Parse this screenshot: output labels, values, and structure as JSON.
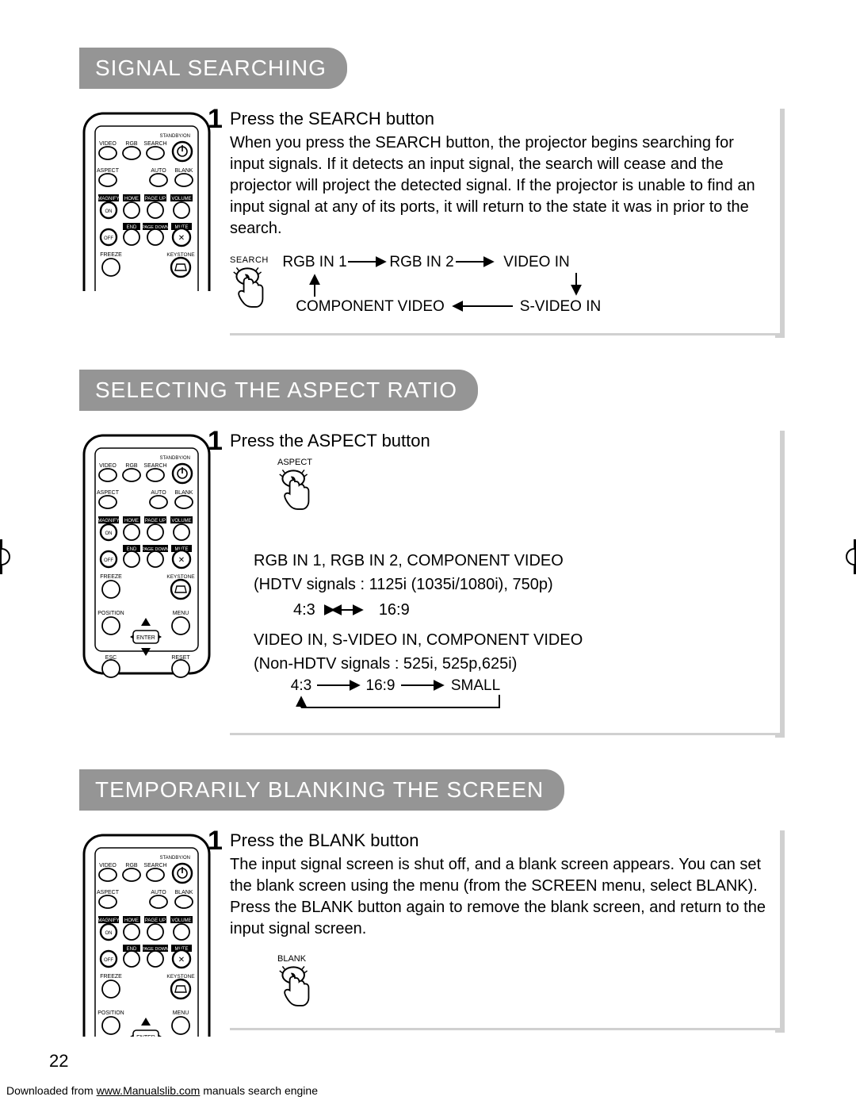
{
  "sections": {
    "s1": {
      "title": "SIGNAL SEARCHING",
      "step_num": "1",
      "step_title": "Press the SEARCH button",
      "body": "When you press the SEARCH button, the projector begins searching for input signals. If it detects an input signal, the search will cease and the projector will project the detected signal. If the projector is unable to find an input signal at any of its ports, it will return to the state it was in prior to the search.",
      "press_label": "SEARCH",
      "flow": {
        "a": "RGB IN 1",
        "b": "RGB IN 2",
        "c": "VIDEO IN",
        "d": "COMPONENT VIDEO",
        "e": "S-VIDEO IN"
      }
    },
    "s2": {
      "title": "SELECTING THE ASPECT RATIO",
      "step_num": "1",
      "step_title": "Press the ASPECT button",
      "press_label": "ASPECT",
      "line1": "RGB IN 1, RGB IN 2, COMPONENT VIDEO",
      "line2": "(HDTV signals : 1125i (1035i/1080i), 750p)",
      "ratio_a": "4:3",
      "ratio_b": "16:9",
      "line3": "VIDEO IN, S-VIDEO IN, COMPONENT VIDEO",
      "line4": "(Non-HDTV signals : 525i, 525p,625i)",
      "ratio2_a": "4:3",
      "ratio2_b": "16:9",
      "ratio2_c": "SMALL"
    },
    "s3": {
      "title": "TEMPORARILY BLANKING THE SCREEN",
      "step_num": "1",
      "step_title": "Press the BLANK button",
      "body": "The input signal screen is shut off, and a blank screen appears. You can set the blank screen using the menu (from the SCREEN menu, select BLANK). Press the BLANK button again to remove the blank screen, and return to the input signal screen.",
      "press_label": "BLANK"
    }
  },
  "remote_labels": {
    "r1": "VIDEO",
    "r2": "RGB",
    "r3": "SEARCH",
    "r4": "STANDBY/ON",
    "r5": "ASPECT",
    "r6": "AUTO",
    "r7": "BLANK",
    "r8": "MAGNIFY",
    "r9": "HOME",
    "r10": "PAGE UP",
    "r11": "VOLUME",
    "r12": "ON",
    "r13": "END",
    "r14": "PAGE DOWN",
    "r15": "MUTE",
    "r16": "OFF",
    "r17": "FREEZE",
    "r18": "KEYSTONE",
    "r19": "POSITION",
    "r20": "MENU",
    "r21": "ENTER",
    "r22": "ESC",
    "r23": "RESET"
  },
  "page_number": "22",
  "footer_prefix": "Downloaded from ",
  "footer_link": "www.Manualslib.com",
  "footer_suffix": " manuals search engine"
}
